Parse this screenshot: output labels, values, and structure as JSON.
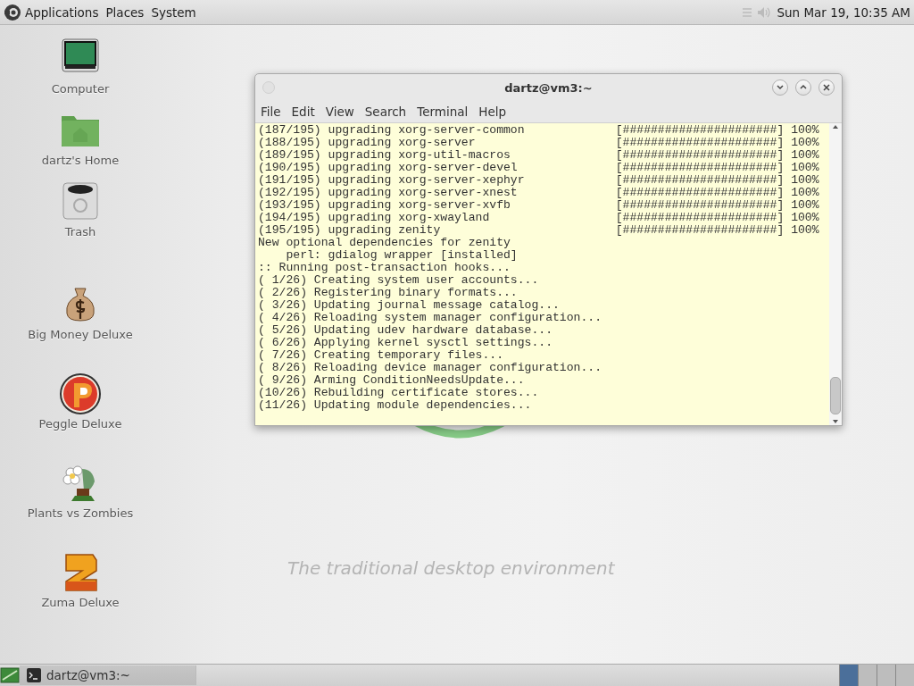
{
  "top_panel": {
    "menus": [
      "Applications",
      "Places",
      "System"
    ],
    "clock": "Sun Mar 19, 10:35 AM"
  },
  "desktop_icons": [
    {
      "label": "Computer",
      "kind": "computer"
    },
    {
      "label": "dartz's Home",
      "kind": "home"
    },
    {
      "label": "Trash",
      "kind": "trash"
    },
    {
      "label": "Big Money Deluxe",
      "kind": "money"
    },
    {
      "label": "Peggle Deluxe",
      "kind": "peggle"
    },
    {
      "label": "Plants vs Zombies",
      "kind": "plants"
    },
    {
      "label": "Zuma Deluxe",
      "kind": "zuma"
    }
  ],
  "wallpaper": {
    "tagline": "The traditional desktop environment"
  },
  "terminal": {
    "title": "dartz@vm3:~",
    "menus": [
      "File",
      "Edit",
      "View",
      "Search",
      "Terminal",
      "Help"
    ],
    "lines": [
      {
        "text": "(187/195) upgrading xorg-server-common",
        "progress": "[######################] 100%"
      },
      {
        "text": "(188/195) upgrading xorg-server",
        "progress": "[######################] 100%"
      },
      {
        "text": "(189/195) upgrading xorg-util-macros",
        "progress": "[######################] 100%"
      },
      {
        "text": "(190/195) upgrading xorg-server-devel",
        "progress": "[######################] 100%"
      },
      {
        "text": "(191/195) upgrading xorg-server-xephyr",
        "progress": "[######################] 100%"
      },
      {
        "text": "(192/195) upgrading xorg-server-xnest",
        "progress": "[######################] 100%"
      },
      {
        "text": "(193/195) upgrading xorg-server-xvfb",
        "progress": "[######################] 100%"
      },
      {
        "text": "(194/195) upgrading xorg-xwayland",
        "progress": "[######################] 100%"
      },
      {
        "text": "(195/195) upgrading zenity",
        "progress": "[######################] 100%"
      },
      {
        "text": "New optional dependencies for zenity"
      },
      {
        "text": "    perl: gdialog wrapper [installed]"
      },
      {
        "text": ":: Running post-transaction hooks..."
      },
      {
        "text": "( 1/26) Creating system user accounts..."
      },
      {
        "text": "( 2/26) Registering binary formats..."
      },
      {
        "text": "( 3/26) Updating journal message catalog..."
      },
      {
        "text": "( 4/26) Reloading system manager configuration..."
      },
      {
        "text": "( 5/26) Updating udev hardware database..."
      },
      {
        "text": "( 6/26) Applying kernel sysctl settings..."
      },
      {
        "text": "( 7/26) Creating temporary files..."
      },
      {
        "text": "( 8/26) Reloading device manager configuration..."
      },
      {
        "text": "( 9/26) Arming ConditionNeedsUpdate..."
      },
      {
        "text": "(10/26) Rebuilding certificate stores..."
      },
      {
        "text": "(11/26) Updating module dependencies..."
      }
    ]
  },
  "bottom_panel": {
    "tasks": [
      {
        "label": "dartz@vm3:~",
        "selected": true
      }
    ],
    "workspaces": [
      {
        "selected": true
      },
      {
        "selected": false
      },
      {
        "selected": false
      },
      {
        "selected": false
      }
    ]
  }
}
